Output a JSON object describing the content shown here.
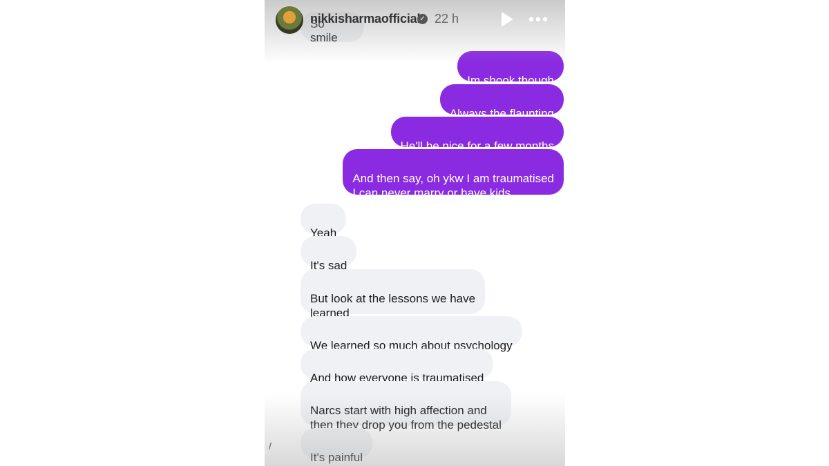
{
  "header": {
    "username": "nikkisharmaofficial",
    "time": "22 h",
    "icons": [
      "verified-badge-icon",
      "play-icon",
      "more-options-icon"
    ]
  },
  "partial_message": "So smile",
  "messages": [
    {
      "direction": "sent",
      "text": "Im shook though"
    },
    {
      "direction": "sent",
      "text": "Always the flaunting"
    },
    {
      "direction": "sent",
      "text": "He'll be nice for a few months"
    },
    {
      "direction": "sent",
      "text": "And then say, oh ykw I am traumatised\nI can never marry or have kids"
    },
    {
      "direction": "received",
      "text": "Yeah"
    },
    {
      "direction": "received",
      "text": "It's sad"
    },
    {
      "direction": "received",
      "text": "But look at the lessons we have\nlearned"
    },
    {
      "direction": "received",
      "text": "We learned so much about psychology"
    },
    {
      "direction": "received",
      "text": "And how everyone is traumatised"
    },
    {
      "direction": "received",
      "text": "Narcs start with high affection and\nthen they drop you from the pedestal"
    },
    {
      "direction": "received",
      "text": "It's painful"
    }
  ],
  "edge_mark": "/",
  "colors": {
    "sent_bubble": "#8a2be2",
    "received_bubble": "#eff1f4",
    "sent_text": "#ffffff",
    "received_text": "#1a1a1a"
  }
}
